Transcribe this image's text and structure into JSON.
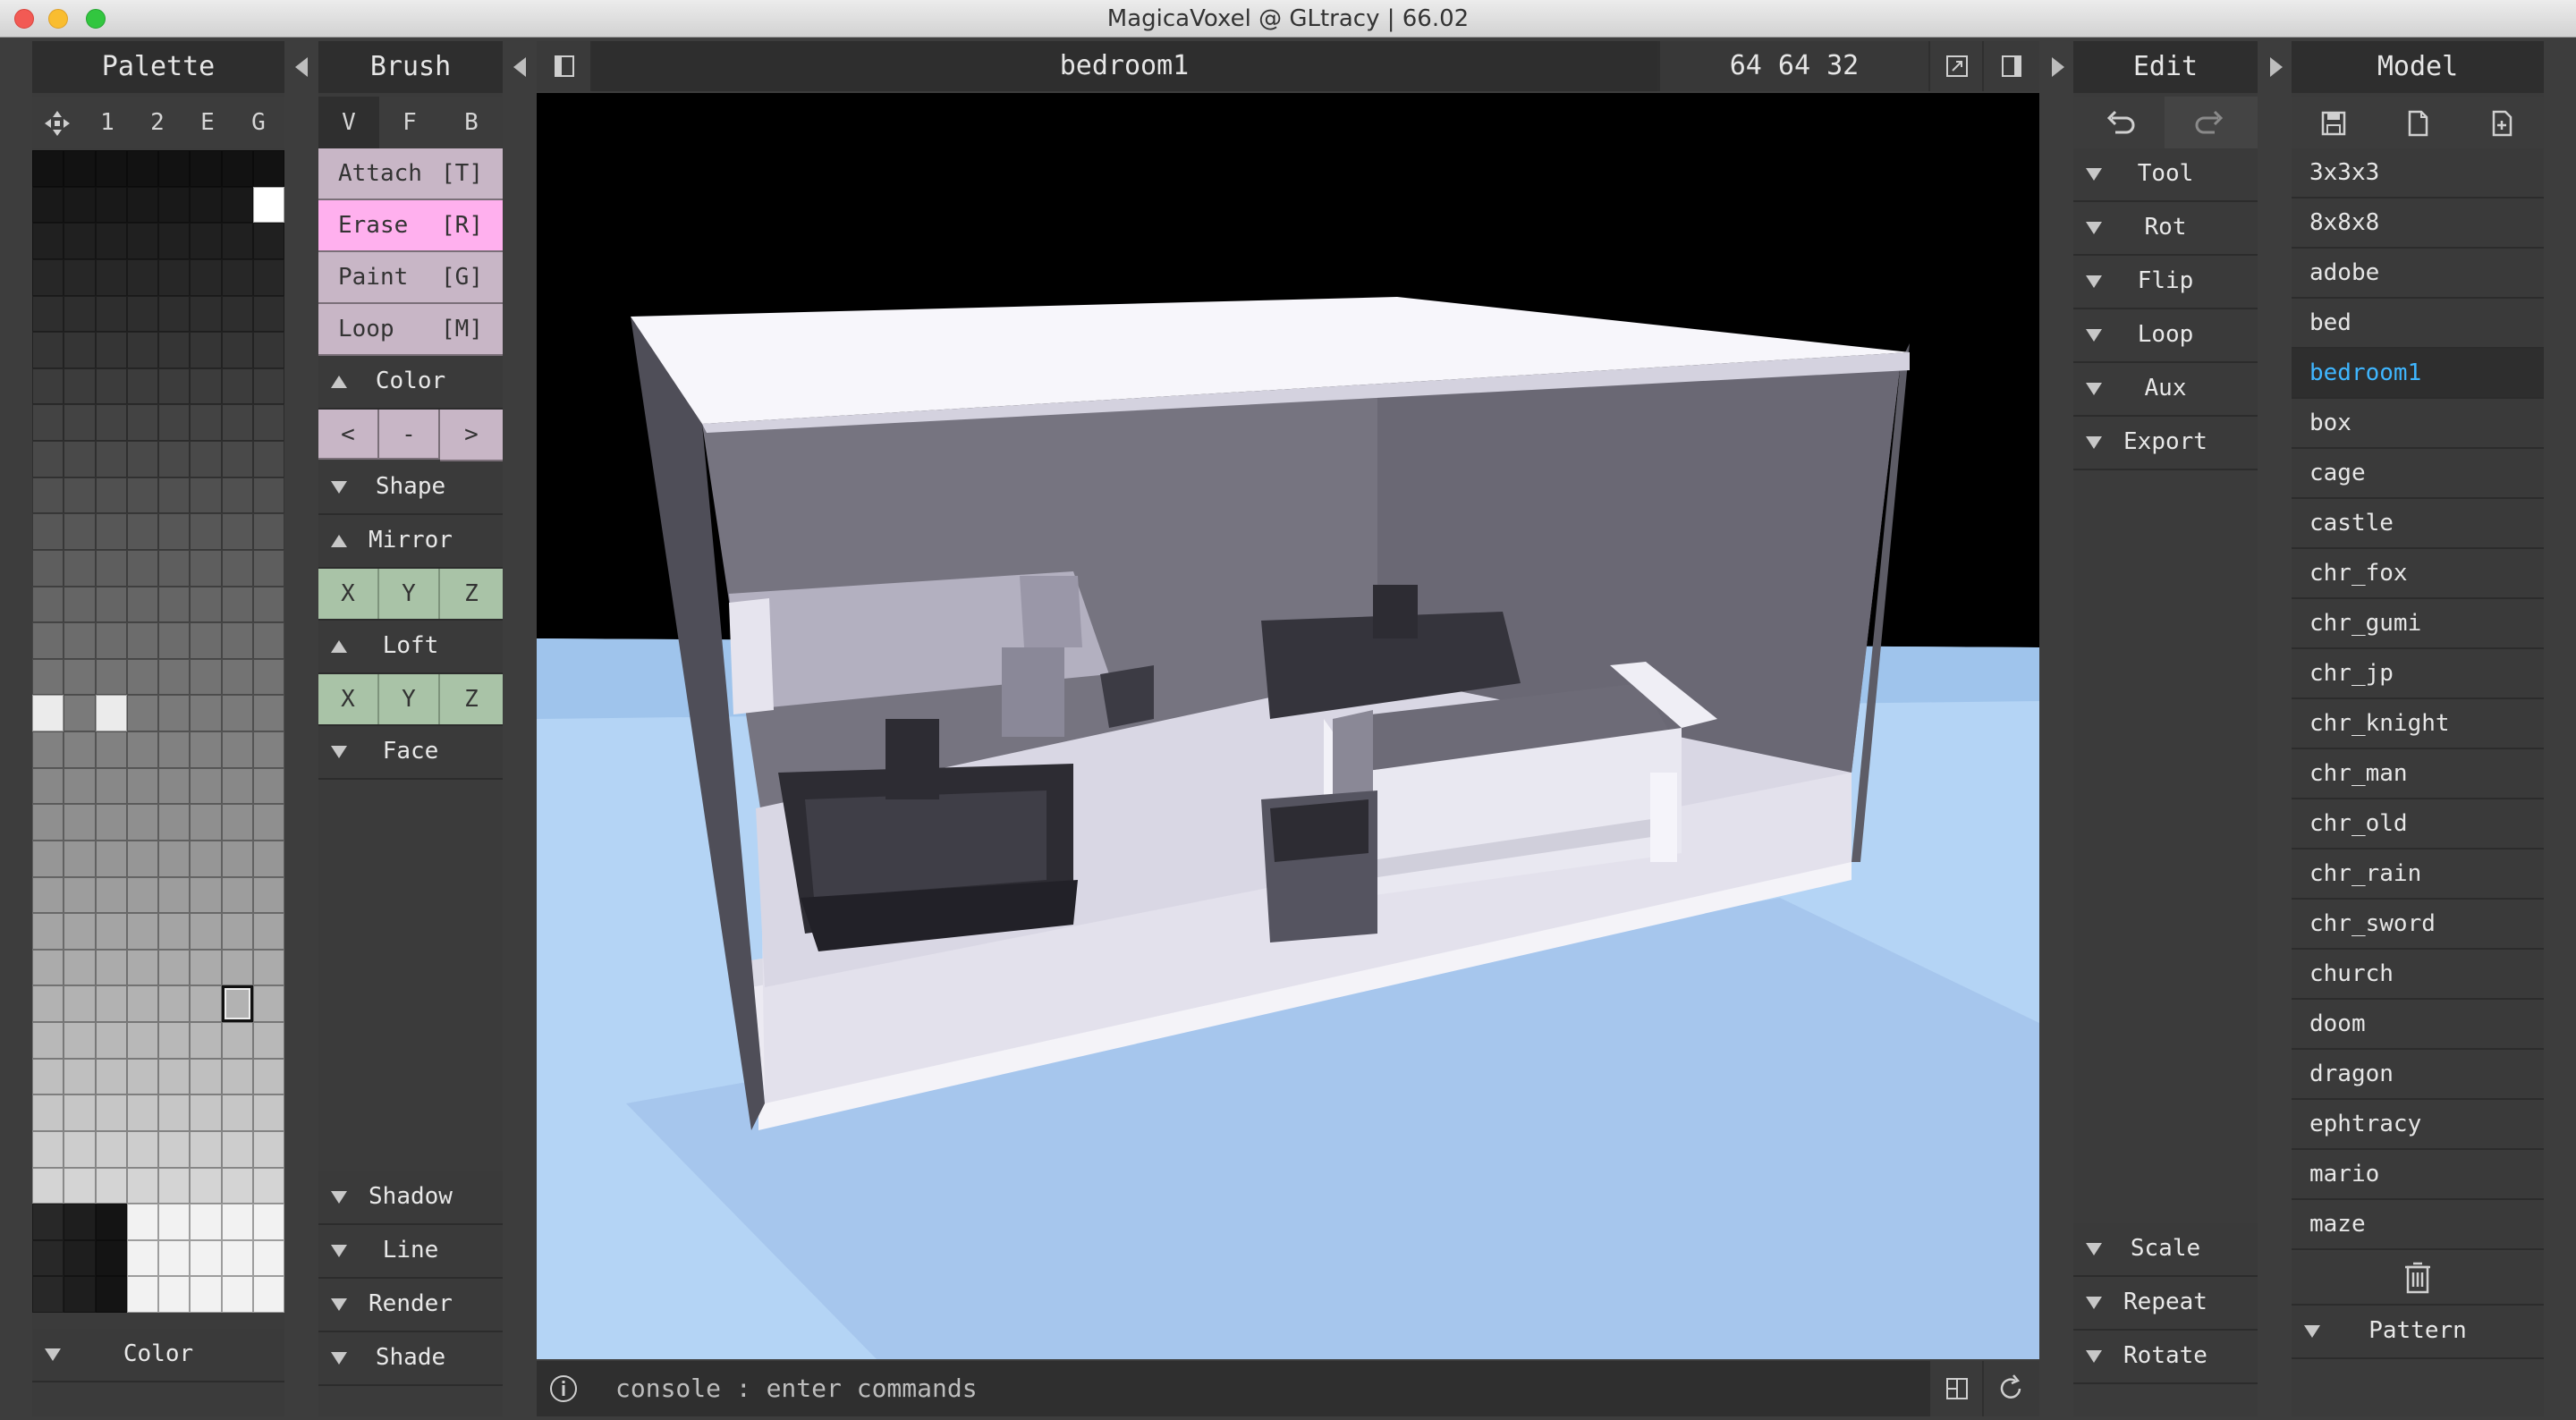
{
  "window": {
    "title": "MagicaVoxel @ GLtracy | 66.02"
  },
  "palette": {
    "header": "Palette",
    "tabs": [
      "1",
      "2",
      "E",
      "G"
    ],
    "footer_label": "Color"
  },
  "brush": {
    "header": "Brush",
    "modes": [
      "V",
      "F",
      "B"
    ],
    "actions": [
      {
        "label": "Attach",
        "key": "[T]"
      },
      {
        "label": "Erase",
        "key": "[R]"
      },
      {
        "label": "Paint",
        "key": "[G]"
      },
      {
        "label": "Loop",
        "key": "[M]"
      }
    ],
    "color_section": "Color",
    "color_nav": [
      "<",
      "-",
      ">"
    ],
    "shape_section": "Shape",
    "mirror_section": "Mirror",
    "mirror_axes": [
      "X",
      "Y",
      "Z"
    ],
    "loft_section": "Loft",
    "loft_axes": [
      "X",
      "Y",
      "Z"
    ],
    "face_section": "Face",
    "bottom_sections": [
      "Shadow",
      "Line",
      "Render",
      "Shade"
    ]
  },
  "viewport": {
    "model_name": "bedroom1",
    "dimensions": "64  64  32",
    "console_placeholder": "console : enter commands"
  },
  "edit": {
    "header": "Edit",
    "sections": [
      "Tool",
      "Rot",
      "Flip",
      "Loop",
      "Aux",
      "Export"
    ],
    "bottom_sections": [
      "Scale",
      "Repeat",
      "Rotate"
    ]
  },
  "model": {
    "header": "Model",
    "items": [
      "3x3x3",
      "8x8x8",
      "adobe",
      "bed",
      "bedroom1",
      "box",
      "cage",
      "castle",
      "chr_fox",
      "chr_gumi",
      "chr_jp",
      "chr_knight",
      "chr_man",
      "chr_old",
      "chr_rain",
      "chr_sword",
      "church",
      "doom",
      "dragon",
      "ephtracy",
      "mario",
      "maze"
    ],
    "selected": "bedroom1",
    "footer_label": "Pattern"
  },
  "colors": {
    "accent_selected": "#3fb6ff",
    "erase_active": "#ffb0ee",
    "brush_button": "#c8b6c6",
    "axis_button": "#a9c3a7",
    "floor": "#b4d4f5"
  }
}
